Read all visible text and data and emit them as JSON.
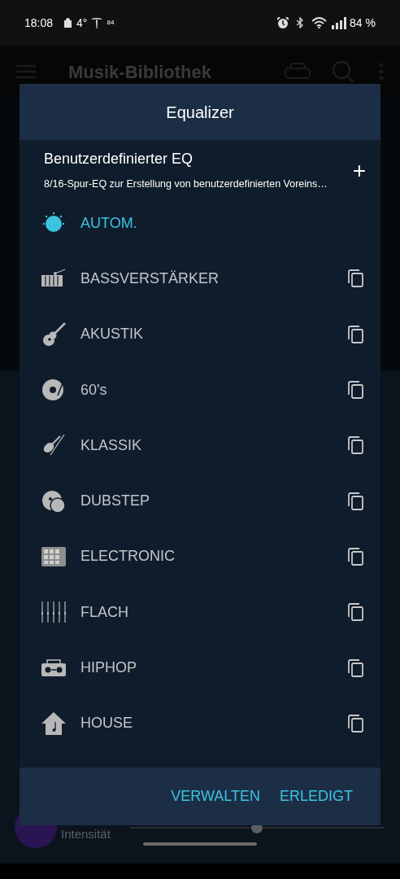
{
  "status_bar": {
    "time": "18:08",
    "temperature": "4°",
    "small_badge": "84",
    "battery": "84 %"
  },
  "app_bar": {
    "title": "Musik-Bibliothek"
  },
  "background": {
    "slider_label": "Intensität",
    "slider": {
      "level": 0.5
    }
  },
  "dialog": {
    "title": "Equalizer",
    "custom": {
      "title": "Benutzerdefinierter EQ",
      "subtitle": "8/16-Spur-EQ zur Erstellung von benutzerdefinierten Voreins…",
      "add": "+"
    },
    "presets": [
      {
        "kind": "knob",
        "label": "AUTOM.",
        "selected": true
      },
      {
        "kind": "xylophone",
        "label": "BASSVERSTÄRKER",
        "selected": false
      },
      {
        "kind": "guitar",
        "label": "AKUSTIK",
        "selected": false
      },
      {
        "kind": "record",
        "label": "60's",
        "selected": false
      },
      {
        "kind": "violin",
        "label": "KLASSIK",
        "selected": false
      },
      {
        "kind": "disc",
        "label": "DUBSTEP",
        "selected": false
      },
      {
        "kind": "pads",
        "label": "ELECTRONIC",
        "selected": false
      },
      {
        "kind": "sliders",
        "label": "FLACH",
        "selected": false
      },
      {
        "kind": "boombox",
        "label": "HIPHOP",
        "selected": false
      },
      {
        "kind": "house",
        "label": "HOUSE",
        "selected": false
      }
    ],
    "buttons": [
      "VERWALTEN",
      "ERLEDIGT"
    ]
  }
}
